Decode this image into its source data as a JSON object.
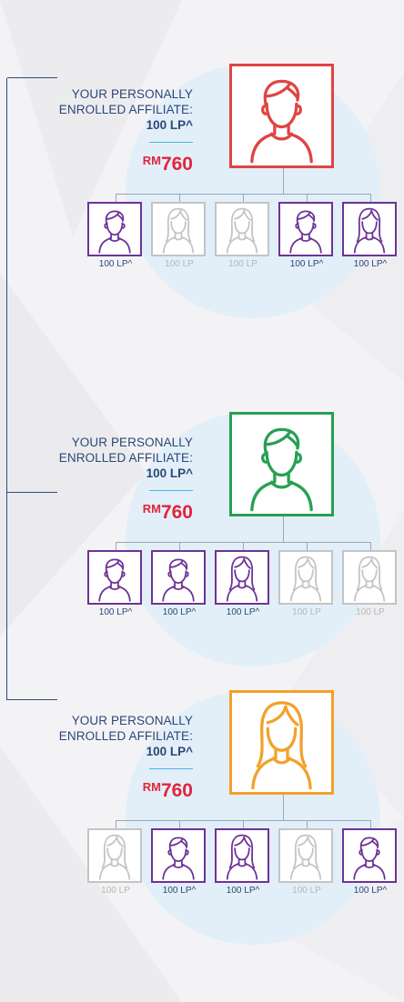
{
  "sections": [
    {
      "title": [
        "YOUR PERSONALLY",
        "ENROLLED AFFILIATE:"
      ],
      "points": "100 LP^",
      "currency": "RM",
      "amount": "760",
      "main_color": "#e04444",
      "main_figure": "male",
      "children": [
        {
          "label": "100 LP^",
          "active": true,
          "figure": "male"
        },
        {
          "label": "100 LP",
          "active": false,
          "figure": "female"
        },
        {
          "label": "100 LP",
          "active": false,
          "figure": "female"
        },
        {
          "label": "100 LP^",
          "active": true,
          "figure": "male"
        },
        {
          "label": "100 LP^",
          "active": true,
          "figure": "female"
        }
      ]
    },
    {
      "title": [
        "YOUR PERSONALLY",
        "ENROLLED AFFILIATE:"
      ],
      "points": "100 LP^",
      "currency": "RM",
      "amount": "760",
      "main_color": "#27a053",
      "main_figure": "male",
      "children": [
        {
          "label": "100 LP^",
          "active": true,
          "figure": "male"
        },
        {
          "label": "100 LP^",
          "active": true,
          "figure": "male"
        },
        {
          "label": "100 LP^",
          "active": true,
          "figure": "female"
        },
        {
          "label": "100 LP",
          "active": false,
          "figure": "female"
        },
        {
          "label": "100 LP",
          "active": false,
          "figure": "female"
        }
      ]
    },
    {
      "title": [
        "YOUR PERSONALLY",
        "ENROLLED AFFILIATE:"
      ],
      "points": "100 LP^",
      "currency": "RM",
      "amount": "760",
      "main_color": "#f2a12a",
      "main_figure": "female",
      "children": [
        {
          "label": "100 LP",
          "active": false,
          "figure": "female"
        },
        {
          "label": "100 LP^",
          "active": true,
          "figure": "male"
        },
        {
          "label": "100 LP^",
          "active": true,
          "figure": "female"
        },
        {
          "label": "100 LP",
          "active": false,
          "figure": "female"
        },
        {
          "label": "100 LP^",
          "active": true,
          "figure": "male"
        }
      ]
    }
  ],
  "colors": {
    "active_child": "#6d3396",
    "inactive_child": "#c4c4c4",
    "text_blue": "#2c4677",
    "money_red": "#e1253d",
    "circle": "#e2eff9",
    "bracket": "#2e4a7c"
  }
}
